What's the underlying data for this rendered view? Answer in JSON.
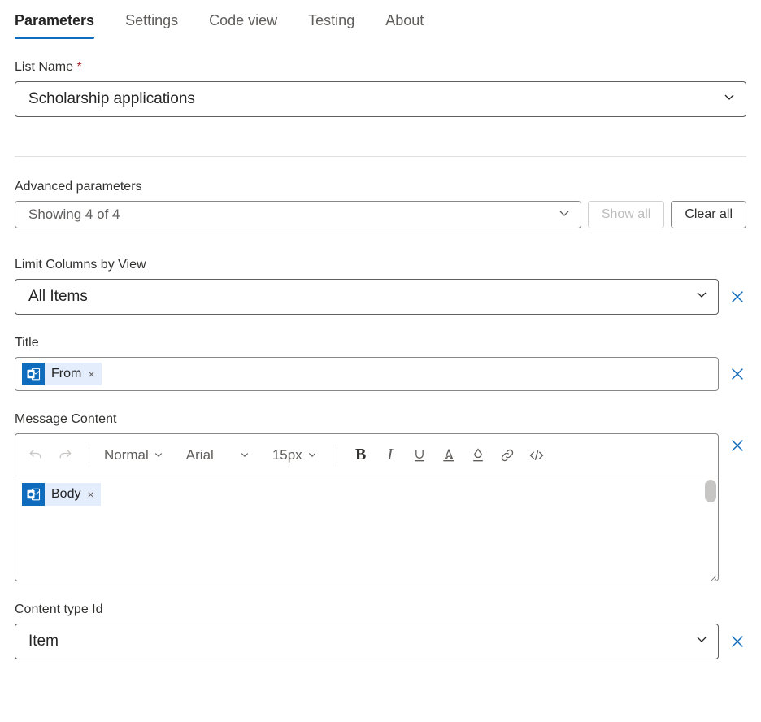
{
  "tabs": [
    {
      "label": "Parameters",
      "active": true
    },
    {
      "label": "Settings",
      "active": false
    },
    {
      "label": "Code view",
      "active": false
    },
    {
      "label": "Testing",
      "active": false
    },
    {
      "label": "About",
      "active": false
    }
  ],
  "fields": {
    "listName": {
      "label": "List Name",
      "required": true,
      "value": "Scholarship applications"
    },
    "advanced": {
      "label": "Advanced parameters",
      "summary": "Showing 4 of 4",
      "showAll": "Show all",
      "clearAll": "Clear all"
    },
    "limitColumns": {
      "label": "Limit Columns by View",
      "value": "All Items"
    },
    "title": {
      "label": "Title",
      "token": "From"
    },
    "messageContent": {
      "label": "Message Content",
      "token": "Body"
    },
    "contentTypeId": {
      "label": "Content type Id",
      "value": "Item"
    }
  },
  "rte": {
    "styleName": "Normal",
    "fontName": "Arial",
    "fontSize": "15px"
  },
  "icons": {
    "tokenX": "×"
  }
}
